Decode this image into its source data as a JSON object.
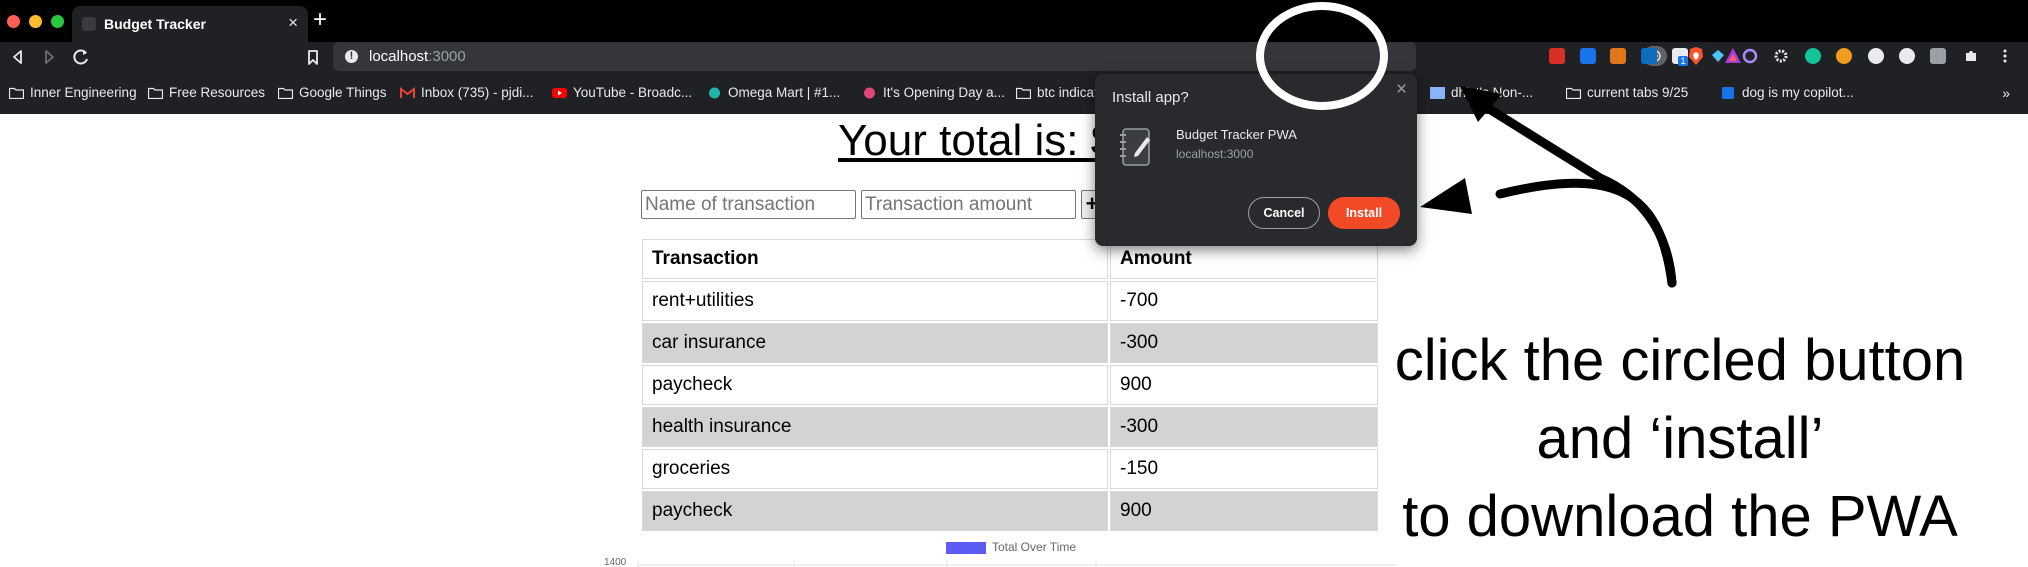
{
  "browser": {
    "tab_title": "Budget Tracker",
    "tab_close": "×",
    "new_tab": "+",
    "url_host": "localhost",
    "url_port": ":3000",
    "info_glyph": "!",
    "bookmarks": [
      {
        "label": "Inner Engineering",
        "icon": "folder-icon"
      },
      {
        "label": "Free Resources",
        "icon": "folder-icon"
      },
      {
        "label": "Google Things",
        "icon": "folder-icon"
      },
      {
        "label": "Inbox (735) - pjdi...",
        "icon": "gmail-icon"
      },
      {
        "label": "YouTube - Broadc...",
        "icon": "youtube-icon"
      },
      {
        "label": "Omega Mart | #1...",
        "icon": "omega-mart-icon"
      },
      {
        "label": "It's Opening Day a...",
        "icon": "site-icon"
      },
      {
        "label": "btc indicat",
        "icon": "folder-icon"
      },
      {
        "label": "dhist's Non-...",
        "icon": "image-icon"
      },
      {
        "label": "current tabs 9/25",
        "icon": "folder-icon"
      },
      {
        "label": "dog is my copilot...",
        "icon": "d-icon"
      }
    ],
    "bookmarks_more": "»",
    "extensions": [
      "ext-red-icon",
      "ext-p-icon",
      "metamask-icon",
      "outlook-icon",
      "ext-badge-icon",
      "ext-diamond-icon",
      "ext-purple-icon",
      "gear-ext-icon",
      "grammarly-icon",
      "ext-orange-icon",
      "ext-circle-icon",
      "ext-s-icon",
      "ext-grey-icon",
      "puzzle-icon",
      "menu-icon"
    ],
    "extension_badge": "1"
  },
  "page": {
    "total_text": "Your total is: $",
    "name_placeholder": "Name of transaction",
    "amount_placeholder": "Transaction amount",
    "add_label": "+",
    "table": {
      "headers": [
        "Transaction",
        "Amount"
      ],
      "rows": [
        [
          "rent+utilities",
          "-700"
        ],
        [
          "car insurance",
          "-300"
        ],
        [
          "paycheck",
          "900"
        ],
        [
          "health insurance",
          "-300"
        ],
        [
          "groceries",
          "-150"
        ],
        [
          "paycheck",
          "900"
        ]
      ]
    },
    "chart_legend": "Total Over Time",
    "y_tick_top": "1400"
  },
  "install_popup": {
    "title": "Install app?",
    "close": "×",
    "app_name": "Budget Tracker PWA",
    "app_origin": "localhost:3000",
    "cancel_label": "Cancel",
    "install_label": "Install"
  },
  "annotation": {
    "line1": "click the circled button",
    "line2": "and ‘install’",
    "line3": "to download the PWA"
  },
  "colors": {
    "tab_bar": "#000000",
    "toolbar": "#202124",
    "install_button": "#f24a27",
    "chart_series": "#5c5bf3",
    "row_shade": "#d3d3d3"
  }
}
